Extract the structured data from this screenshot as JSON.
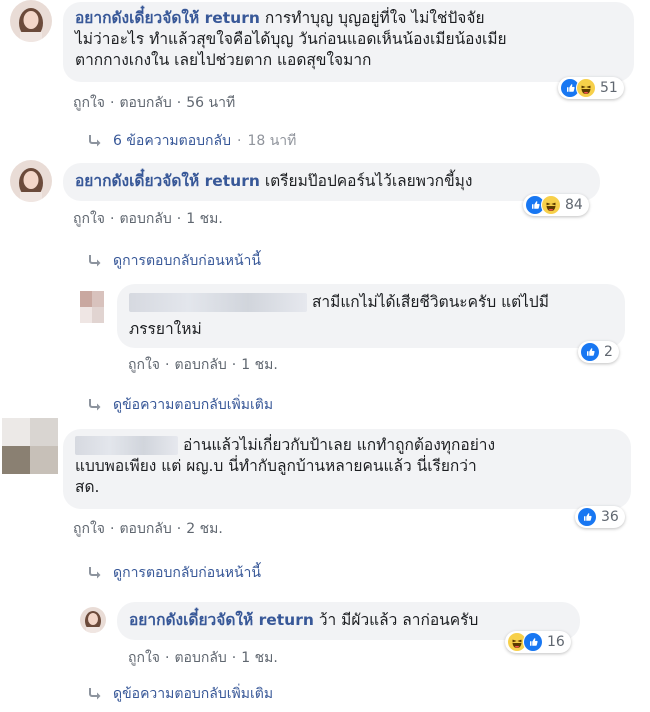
{
  "labels": {
    "like": "ถูกใจ",
    "reply": "ตอบกลับ"
  },
  "comments": [
    {
      "author": "อยากดังเดี๋ยวจัดให้ return",
      "text_line1": "การทำบุญ บุญอยู่ที่ใจ ไม่ใช่ปัจจัย",
      "text_line2": "ไม่ว่าอะไร ทำแล้วสุขใจคือได้บุญ วันก่อนแอดเห็นน้องเมียน้องเมีย",
      "text_line3": "ตากกางเกงใน เลยไปช่วยตาก แอดสุขใจมาก",
      "time": "56 นาที",
      "reaction_count": "51",
      "reply_count_label": "6 ข้อความตอบกลับ",
      "reply_time": "18 นาที"
    },
    {
      "author": "อยากดังเดี๋ยวจัดให้ return",
      "text": "เตรียมป๊อปคอร์นไว้เลยพวกขี้มุง",
      "time": "1 ชม.",
      "reaction_count": "84",
      "prev_replies": "ดูการตอบกลับก่อนหน้านี้"
    },
    {
      "text_line1": "สามีแกไม่ได้เสียชีวิตนะครับ แต่ไปมี",
      "text_line2": "ภรรยาใหม่",
      "time": "1 ชม.",
      "reaction_count": "2",
      "more_replies": "ดูข้อความตอบกลับเพิ่มเติม"
    },
    {
      "text_line1": "อ่านแล้วไม่เกี่ยวกับป้าเลย แกทำถูกต้องทุกอย่าง",
      "text_line2": "แบบพอเพียง แต่ ผญ.บ นี่ทำกับลูกบ้านหลายคนแล้ว นี่เรียกว่า",
      "text_line3": "สด.",
      "time": "2 ชม.",
      "reaction_count": "36",
      "prev_replies": "ดูการตอบกลับก่อนหน้านี้"
    },
    {
      "author": "อยากดังเดี๋ยวจัดให้ return",
      "text": "ว้า มีผัวแล้ว ลาก่อนครับ",
      "time": "1 ชม.",
      "reaction_count": "16",
      "more_replies": "ดูข้อความตอบกลับเพิ่มเติม"
    }
  ]
}
